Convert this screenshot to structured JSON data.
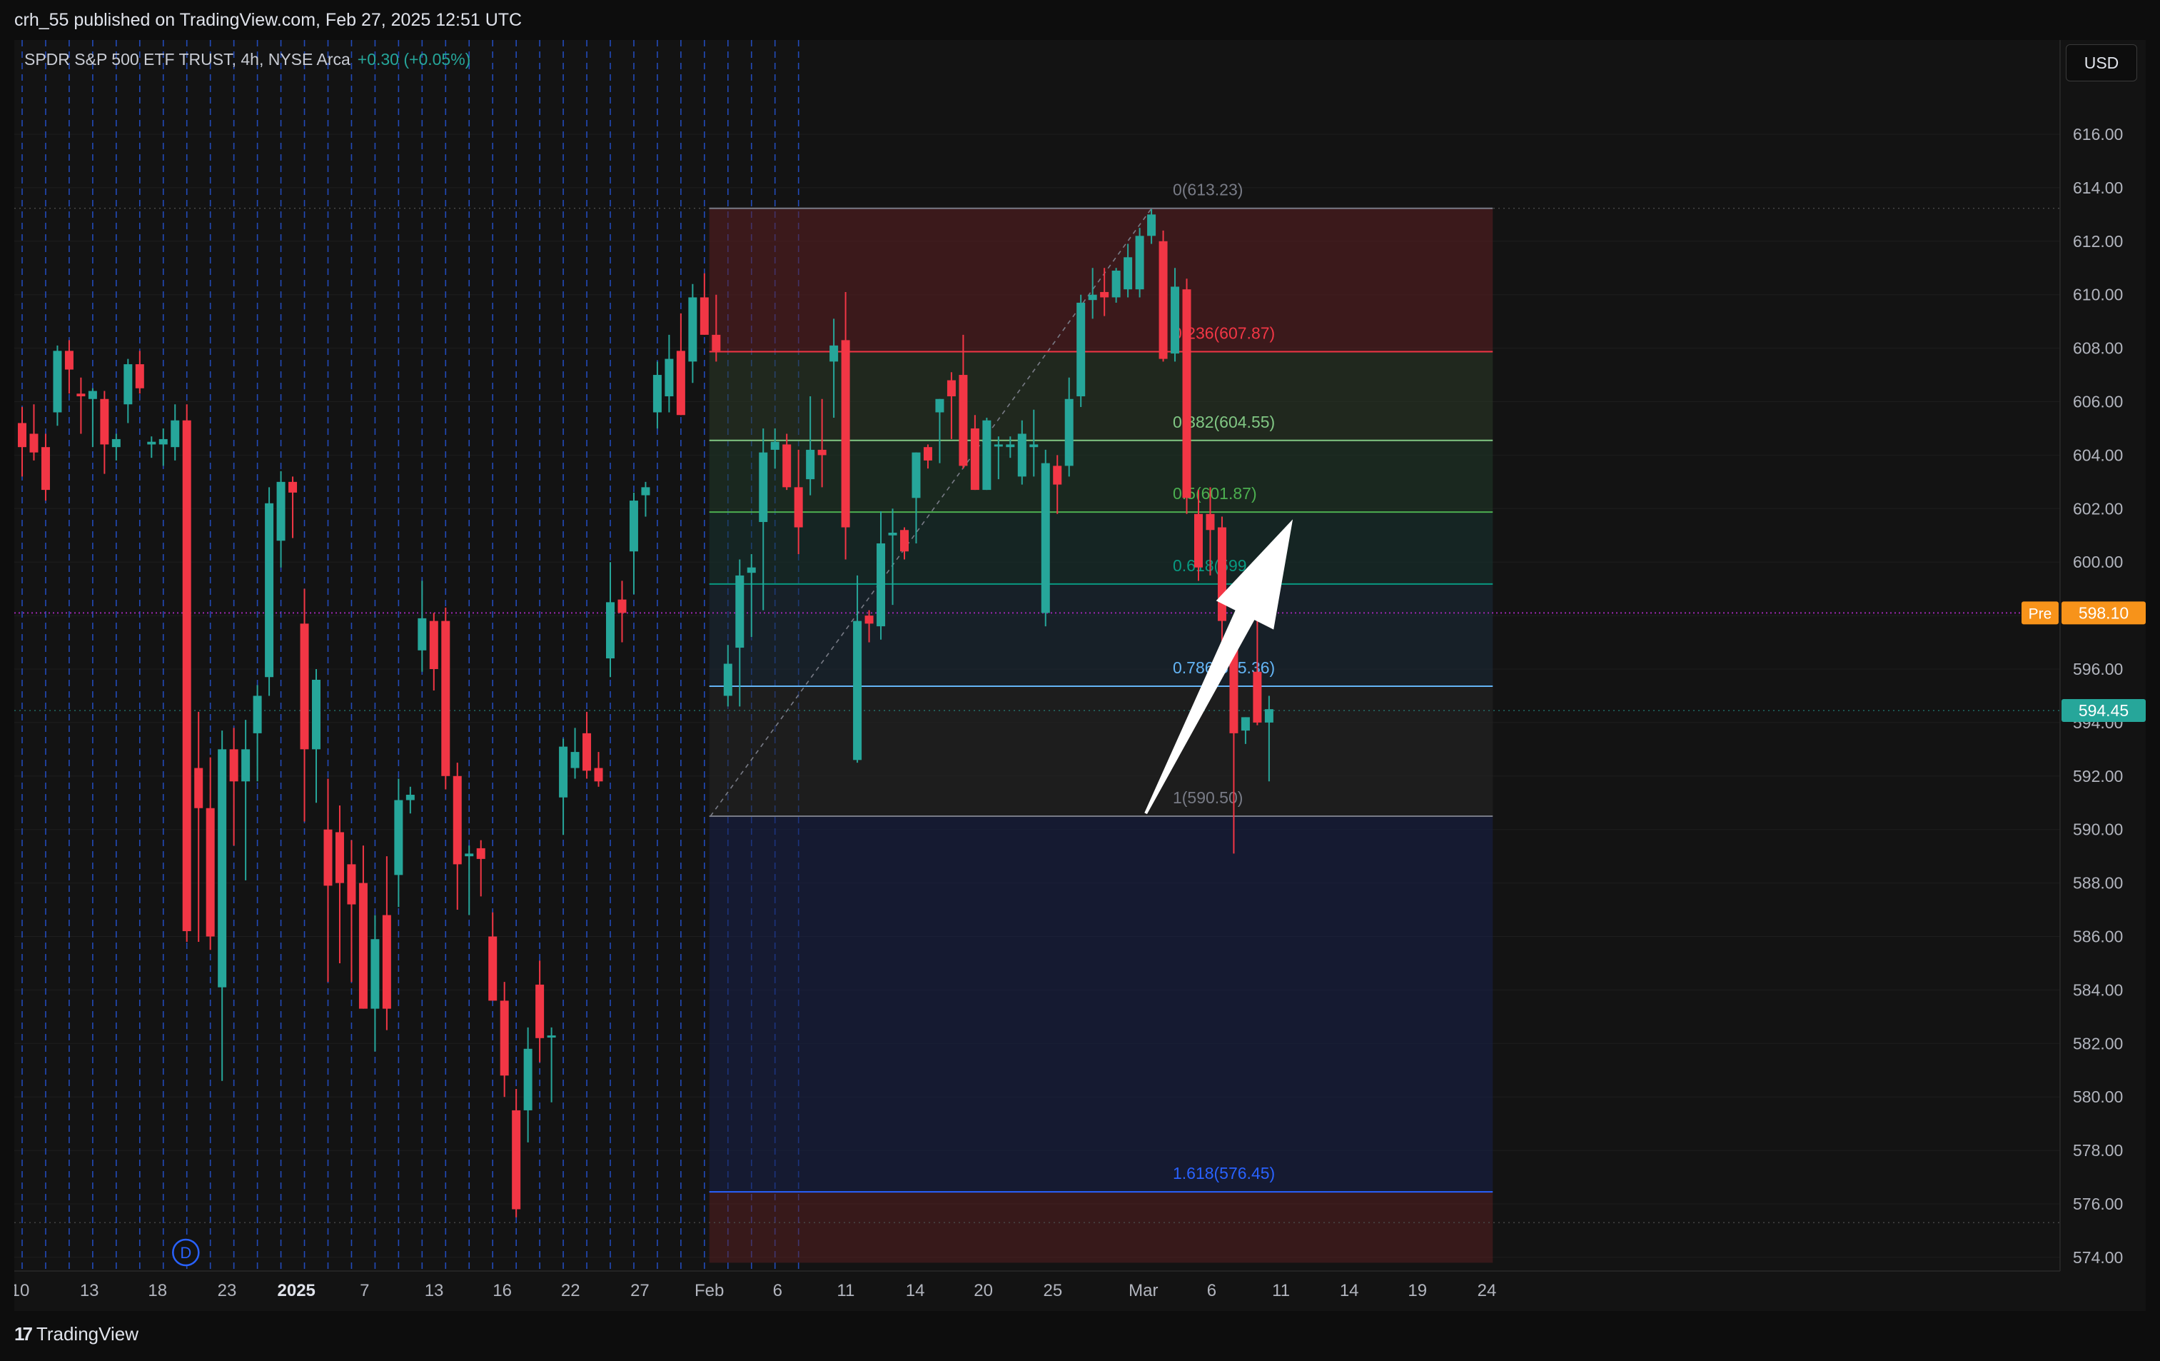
{
  "header": {
    "published": "crh_55 published on TradingView.com, Feb 27, 2025 12:51 UTC"
  },
  "symbol": {
    "name": "SPDR S&P 500 ETF TRUST, 4h, NYSE Arca",
    "change": "+0.30 (+0.05%)"
  },
  "currency_button": "USD",
  "footer": {
    "brand": "TradingView"
  },
  "colors": {
    "up": "#26a69a",
    "down": "#f23645",
    "pre_label": "#f7931a",
    "last_label": "#26a69a",
    "grid_dash": "#2962ff",
    "background": "#131313"
  },
  "chart_data": {
    "type": "candlestick",
    "title": "",
    "xlabel": "",
    "ylabel": "",
    "ylim": [
      573.0,
      618.0
    ],
    "y_ticks": [
      "616.00",
      "614.00",
      "612.00",
      "610.00",
      "608.00",
      "606.00",
      "604.00",
      "602.00",
      "600.00",
      "598.00",
      "596.00",
      "594.00",
      "592.00",
      "590.00",
      "588.00",
      "586.00",
      "584.00",
      "582.00",
      "580.00",
      "578.00",
      "576.00",
      "574.00"
    ],
    "x_labels": [
      {
        "t": "10",
        "b": 0.3
      },
      {
        "t": "13",
        "b": 6.2
      },
      {
        "t": "18",
        "b": 12.0
      },
      {
        "t": "23",
        "b": 17.9
      },
      {
        "t": "2025",
        "b": 23.8,
        "bold": true
      },
      {
        "t": "7",
        "b": 29.6
      },
      {
        "t": "13",
        "b": 35.5
      },
      {
        "t": "16",
        "b": 41.3
      },
      {
        "t": "22",
        "b": 47.1
      },
      {
        "t": "27",
        "b": 53.0
      },
      {
        "t": "Feb",
        "b": 58.9
      },
      {
        "t": "6",
        "b": 64.7
      },
      {
        "t": "11",
        "b": 70.5
      },
      {
        "t": "14",
        "b": 76.4
      },
      {
        "t": "20",
        "b": 82.2
      },
      {
        "t": "25",
        "b": 88.1
      },
      {
        "t": "Mar",
        "b": 95.8
      },
      {
        "t": "6",
        "b": 101.6
      },
      {
        "t": "11",
        "b": 107.5
      },
      {
        "t": "14",
        "b": 113.3
      },
      {
        "t": "19",
        "b": 119.1
      },
      {
        "t": "24",
        "b": 125.0
      }
    ],
    "candles": [
      {
        "o": 605.2,
        "h": 605.8,
        "l": 603.2,
        "c": 604.3
      },
      {
        "o": 604.8,
        "h": 605.9,
        "l": 603.8,
        "c": 604.1
      },
      {
        "o": 604.3,
        "h": 604.8,
        "l": 602.3,
        "c": 602.7
      },
      {
        "o": 605.6,
        "h": 608.1,
        "l": 605.1,
        "c": 607.9
      },
      {
        "o": 607.9,
        "h": 608.3,
        "l": 606.3,
        "c": 607.2
      },
      {
        "o": 606.3,
        "h": 606.9,
        "l": 604.8,
        "c": 606.2
      },
      {
        "o": 606.1,
        "h": 606.5,
        "l": 604.3,
        "c": 606.4
      },
      {
        "o": 606.1,
        "h": 606.4,
        "l": 603.3,
        "c": 604.4
      },
      {
        "o": 604.3,
        "h": 604.8,
        "l": 603.8,
        "c": 604.6
      },
      {
        "o": 605.9,
        "h": 607.6,
        "l": 605.2,
        "c": 607.4
      },
      {
        "o": 607.4,
        "h": 607.9,
        "l": 606.3,
        "c": 606.5
      },
      {
        "o": 604.4,
        "h": 604.7,
        "l": 603.9,
        "c": 604.5
      },
      {
        "o": 604.4,
        "h": 605.0,
        "l": 603.6,
        "c": 604.6
      },
      {
        "o": 604.3,
        "h": 605.9,
        "l": 603.8,
        "c": 605.3
      },
      {
        "o": 605.3,
        "h": 605.9,
        "l": 585.8,
        "c": 586.2
      },
      {
        "o": 592.3,
        "h": 594.4,
        "l": 585.8,
        "c": 590.8
      },
      {
        "o": 590.8,
        "h": 592.7,
        "l": 585.5,
        "c": 586.0
      },
      {
        "o": 584.1,
        "h": 593.7,
        "l": 580.6,
        "c": 593.0
      },
      {
        "o": 593.0,
        "h": 593.8,
        "l": 589.4,
        "c": 591.8
      },
      {
        "o": 591.8,
        "h": 594.1,
        "l": 588.1,
        "c": 593.0
      },
      {
        "o": 593.6,
        "h": 595.4,
        "l": 591.8,
        "c": 595.0
      },
      {
        "o": 595.7,
        "h": 602.8,
        "l": 595.0,
        "c": 602.2
      },
      {
        "o": 600.8,
        "h": 603.4,
        "l": 599.8,
        "c": 603.0
      },
      {
        "o": 603.0,
        "h": 603.2,
        "l": 600.9,
        "c": 602.6
      },
      {
        "o": 597.7,
        "h": 599.0,
        "l": 590.3,
        "c": 593.0
      },
      {
        "o": 593.0,
        "h": 596.0,
        "l": 591.0,
        "c": 595.6
      },
      {
        "o": 590.0,
        "h": 591.9,
        "l": 584.3,
        "c": 587.9
      },
      {
        "o": 589.9,
        "h": 590.9,
        "l": 585.0,
        "c": 588.0
      },
      {
        "o": 588.7,
        "h": 589.6,
        "l": 584.3,
        "c": 587.2
      },
      {
        "o": 588.0,
        "h": 589.4,
        "l": 584.1,
        "c": 583.3
      },
      {
        "o": 583.3,
        "h": 586.8,
        "l": 581.7,
        "c": 585.9
      },
      {
        "o": 586.8,
        "h": 589.0,
        "l": 582.5,
        "c": 583.3
      },
      {
        "o": 588.3,
        "h": 591.9,
        "l": 587.1,
        "c": 591.1
      },
      {
        "o": 591.1,
        "h": 591.6,
        "l": 590.6,
        "c": 591.3
      },
      {
        "o": 596.7,
        "h": 599.3,
        "l": 595.9,
        "c": 597.9
      },
      {
        "o": 597.8,
        "h": 598.1,
        "l": 595.2,
        "c": 596.0
      },
      {
        "o": 597.8,
        "h": 598.3,
        "l": 591.5,
        "c": 592.0
      },
      {
        "o": 592.0,
        "h": 592.5,
        "l": 587.0,
        "c": 588.7
      },
      {
        "o": 589.0,
        "h": 589.4,
        "l": 586.8,
        "c": 589.1
      },
      {
        "o": 589.3,
        "h": 589.6,
        "l": 587.5,
        "c": 588.9
      },
      {
        "o": 586.0,
        "h": 586.9,
        "l": 584.1,
        "c": 583.6
      },
      {
        "o": 583.6,
        "h": 584.3,
        "l": 580.0,
        "c": 580.8
      },
      {
        "o": 579.5,
        "h": 580.3,
        "l": 575.5,
        "c": 575.8
      },
      {
        "o": 579.5,
        "h": 582.6,
        "l": 578.3,
        "c": 581.8
      },
      {
        "o": 584.2,
        "h": 585.1,
        "l": 581.3,
        "c": 582.2
      },
      {
        "o": 582.3,
        "h": 582.6,
        "l": 579.8,
        "c": 582.3
      },
      {
        "o": 591.2,
        "h": 593.4,
        "l": 589.8,
        "c": 593.1
      },
      {
        "o": 592.3,
        "h": 593.8,
        "l": 591.9,
        "c": 592.9
      },
      {
        "o": 593.6,
        "h": 594.4,
        "l": 591.9,
        "c": 592.2
      },
      {
        "o": 592.3,
        "h": 592.9,
        "l": 591.6,
        "c": 591.8
      },
      {
        "o": 596.4,
        "h": 600.0,
        "l": 595.7,
        "c": 598.5
      },
      {
        "o": 598.6,
        "h": 599.3,
        "l": 597.0,
        "c": 598.1
      },
      {
        "o": 600.4,
        "h": 602.6,
        "l": 598.8,
        "c": 602.3
      },
      {
        "o": 602.5,
        "h": 603.0,
        "l": 601.7,
        "c": 602.8
      },
      {
        "o": 605.6,
        "h": 607.5,
        "l": 605.0,
        "c": 607.0
      },
      {
        "o": 606.2,
        "h": 608.5,
        "l": 605.6,
        "c": 607.6
      },
      {
        "o": 607.9,
        "h": 609.3,
        "l": 605.6,
        "c": 605.5
      },
      {
        "o": 607.5,
        "h": 610.4,
        "l": 606.7,
        "c": 609.9
      },
      {
        "o": 609.9,
        "h": 610.8,
        "l": 608.6,
        "c": 608.5
      },
      {
        "o": 608.5,
        "h": 610.0,
        "l": 607.5,
        "c": 607.9
      },
      {
        "o": 595.0,
        "h": 596.9,
        "l": 594.6,
        "c": 596.2
      },
      {
        "o": 596.8,
        "h": 600.1,
        "l": 594.6,
        "c": 599.5
      },
      {
        "o": 599.6,
        "h": 600.3,
        "l": 597.2,
        "c": 599.8
      },
      {
        "o": 601.5,
        "h": 605.0,
        "l": 598.2,
        "c": 604.1
      },
      {
        "o": 604.2,
        "h": 605.0,
        "l": 603.5,
        "c": 604.5
      },
      {
        "o": 604.4,
        "h": 604.8,
        "l": 602.7,
        "c": 602.8
      },
      {
        "o": 602.8,
        "h": 604.2,
        "l": 600.3,
        "c": 601.3
      },
      {
        "o": 603.1,
        "h": 606.2,
        "l": 602.5,
        "c": 604.2
      },
      {
        "o": 604.2,
        "h": 606.1,
        "l": 602.8,
        "c": 604.0
      },
      {
        "o": 607.5,
        "h": 609.1,
        "l": 605.4,
        "c": 608.1
      },
      {
        "o": 608.3,
        "h": 610.1,
        "l": 600.1,
        "c": 601.3
      },
      {
        "o": 592.6,
        "h": 599.5,
        "l": 592.5,
        "c": 597.8
      },
      {
        "o": 598.0,
        "h": 598.2,
        "l": 597.0,
        "c": 597.7
      },
      {
        "o": 597.6,
        "h": 601.9,
        "l": 597.1,
        "c": 600.7
      },
      {
        "o": 601.0,
        "h": 602.0,
        "l": 598.4,
        "c": 601.1
      },
      {
        "o": 601.2,
        "h": 601.3,
        "l": 600.1,
        "c": 600.4
      },
      {
        "o": 602.4,
        "h": 603.9,
        "l": 600.7,
        "c": 604.1
      },
      {
        "o": 604.3,
        "h": 604.4,
        "l": 603.5,
        "c": 603.8
      },
      {
        "o": 605.6,
        "h": 606.0,
        "l": 603.7,
        "c": 606.1
      },
      {
        "o": 606.8,
        "h": 607.1,
        "l": 604.6,
        "c": 606.2
      },
      {
        "o": 607.0,
        "h": 608.5,
        "l": 603.5,
        "c": 603.6
      },
      {
        "o": 605.0,
        "h": 605.5,
        "l": 603.7,
        "c": 602.7
      },
      {
        "o": 602.7,
        "h": 605.4,
        "l": 603.4,
        "c": 605.3
      },
      {
        "o": 604.4,
        "h": 604.7,
        "l": 603.1,
        "c": 604.4
      },
      {
        "o": 604.3,
        "h": 604.7,
        "l": 603.9,
        "c": 604.4
      },
      {
        "o": 603.2,
        "h": 605.3,
        "l": 602.9,
        "c": 604.8
      },
      {
        "o": 604.3,
        "h": 605.7,
        "l": 603.2,
        "c": 604.4
      },
      {
        "o": 598.1,
        "h": 604.2,
        "l": 597.6,
        "c": 603.7
      },
      {
        "o": 603.6,
        "h": 604.0,
        "l": 601.8,
        "c": 602.9
      },
      {
        "o": 603.6,
        "h": 606.9,
        "l": 603.2,
        "c": 606.1
      },
      {
        "o": 606.2,
        "h": 610.0,
        "l": 605.8,
        "c": 609.7
      },
      {
        "o": 609.8,
        "h": 611.0,
        "l": 609.1,
        "c": 610.0
      },
      {
        "o": 610.1,
        "h": 611.0,
        "l": 609.2,
        "c": 609.9
      },
      {
        "o": 609.9,
        "h": 611.0,
        "l": 609.7,
        "c": 610.9
      },
      {
        "o": 610.2,
        "h": 611.9,
        "l": 609.9,
        "c": 611.4
      },
      {
        "o": 610.2,
        "h": 612.5,
        "l": 609.9,
        "c": 612.2
      },
      {
        "o": 612.2,
        "h": 613.2,
        "l": 611.9,
        "c": 613.0
      },
      {
        "o": 612.0,
        "h": 612.4,
        "l": 607.5,
        "c": 607.6
      },
      {
        "o": 607.8,
        "h": 611.0,
        "l": 607.5,
        "c": 610.3
      },
      {
        "o": 610.2,
        "h": 610.6,
        "l": 601.8,
        "c": 602.4
      },
      {
        "o": 601.8,
        "h": 602.7,
        "l": 599.3,
        "c": 599.8
      },
      {
        "o": 601.8,
        "h": 602.8,
        "l": 599.5,
        "c": 601.2
      },
      {
        "o": 601.3,
        "h": 601.7,
        "l": 596.3,
        "c": 597.8
      },
      {
        "o": 597.1,
        "h": 597.6,
        "l": 589.1,
        "c": 593.6
      },
      {
        "o": 593.7,
        "h": 593.9,
        "l": 593.2,
        "c": 594.2
      },
      {
        "o": 595.9,
        "h": 599.5,
        "l": 593.9,
        "c": 594.0
      },
      {
        "o": 594.0,
        "h": 595.0,
        "l": 591.8,
        "c": 594.5
      }
    ],
    "fib_levels": [
      {
        "label": "0(613.23)",
        "value": 613.23,
        "color": "#787b86"
      },
      {
        "label": "0.236(607.87)",
        "value": 607.87,
        "color": "#f23645"
      },
      {
        "label": "0.382(604.55)",
        "value": 604.55,
        "color": "#81c784"
      },
      {
        "label": "0.5(601.87)",
        "value": 601.87,
        "color": "#4caf50"
      },
      {
        "label": "0.618(599.18)",
        "value": 599.18,
        "color": "#089981"
      },
      {
        "label": "0.786(595.36)",
        "value": 595.36,
        "color": "#64b5f6"
      },
      {
        "label": "1(590.50)",
        "value": 590.5,
        "color": "#787b86"
      },
      {
        "label": "1.618(576.45)",
        "value": 576.45,
        "color": "#2962ff"
      }
    ],
    "fib_extra_below": 573.8,
    "fib_start_bar": 58.9,
    "fib_end_bar": 125.5,
    "fib_anchor": {
      "bar1": 59.0,
      "price1": 590.5,
      "bar2": 96.5,
      "price2": 613.23
    },
    "pre_price": {
      "label": "Pre",
      "value": 598.1,
      "text": "598.10"
    },
    "last_price": {
      "value": 594.45,
      "text": "594.45"
    },
    "dotted_top": 613.23,
    "dotted_bottom": 575.3,
    "arrow": {
      "from_bar": 96.0,
      "from_price": 590.6,
      "to_bar": 108.5,
      "to_price": 601.6
    },
    "dividend_marker": {
      "bar": 14.4,
      "label": "D"
    }
  }
}
